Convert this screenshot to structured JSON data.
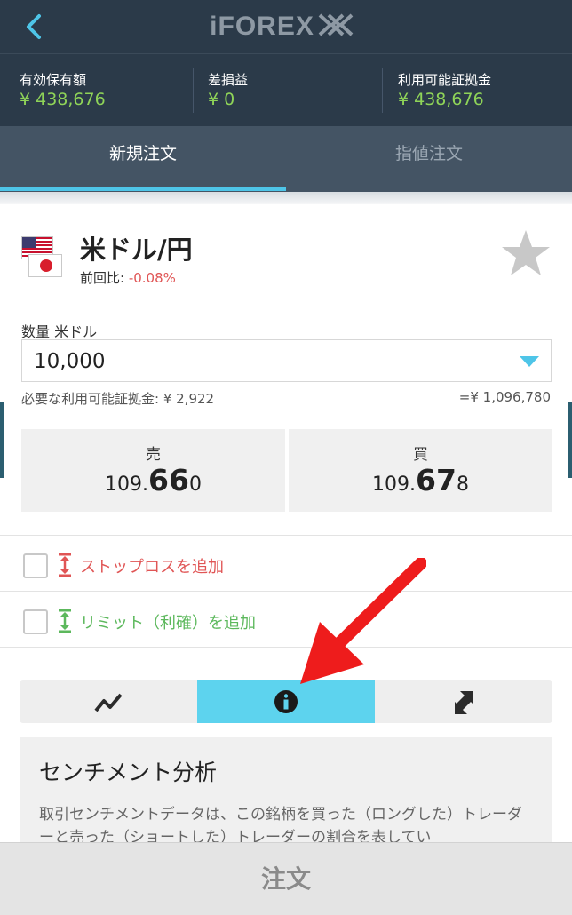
{
  "header": {
    "logo_text": "iFOREX",
    "back_icon": "chevron-left-icon"
  },
  "stats": [
    {
      "label": "有効保有額",
      "value": "¥ 438,676"
    },
    {
      "label": "差損益",
      "value": "¥ 0"
    },
    {
      "label": "利用可能証拠金",
      "value": "¥ 438,676"
    }
  ],
  "tabs": [
    {
      "label": "新規注文",
      "active": true
    },
    {
      "label": "指値注文",
      "active": false
    }
  ],
  "instrument": {
    "name": "米ドル/円",
    "change_label": "前回比: ",
    "change_value": "-0.08%",
    "favorite_icon": "star-icon"
  },
  "quantity": {
    "label": "数量 米ドル",
    "value": "10,000"
  },
  "margin": {
    "required_label": "必要な利用可能証拠金: ¥ 2,922",
    "notional": "=¥ 1,096,780"
  },
  "prices": {
    "sell": {
      "label": "売",
      "prefix": "109.",
      "big": "66",
      "suffix": "0"
    },
    "buy": {
      "label": "買",
      "prefix": "109.",
      "big": "67",
      "suffix": "8"
    }
  },
  "options": {
    "stop_loss_label": "ストップロスを追加",
    "limit_label": "リミット（利確）を追加"
  },
  "segments": [
    {
      "icon": "line-chart-icon",
      "active": false
    },
    {
      "icon": "info-icon",
      "active": true
    },
    {
      "icon": "swap-icon",
      "active": false
    }
  ],
  "sentiment": {
    "title": "センチメント分析",
    "text": "取引センチメントデータは、この銘柄を買った（ロングした）トレーダーと売った（ショートした）トレーダーの割合を表してい"
  },
  "order_button": "注文",
  "colors": {
    "header_bg": "#2b3a49",
    "tabs_bg": "#445464",
    "accent_blue": "#4ec5e8",
    "positive_green": "#8fd458",
    "negative_red": "#e05555",
    "annotation_arrow": "#ee1c1c"
  }
}
